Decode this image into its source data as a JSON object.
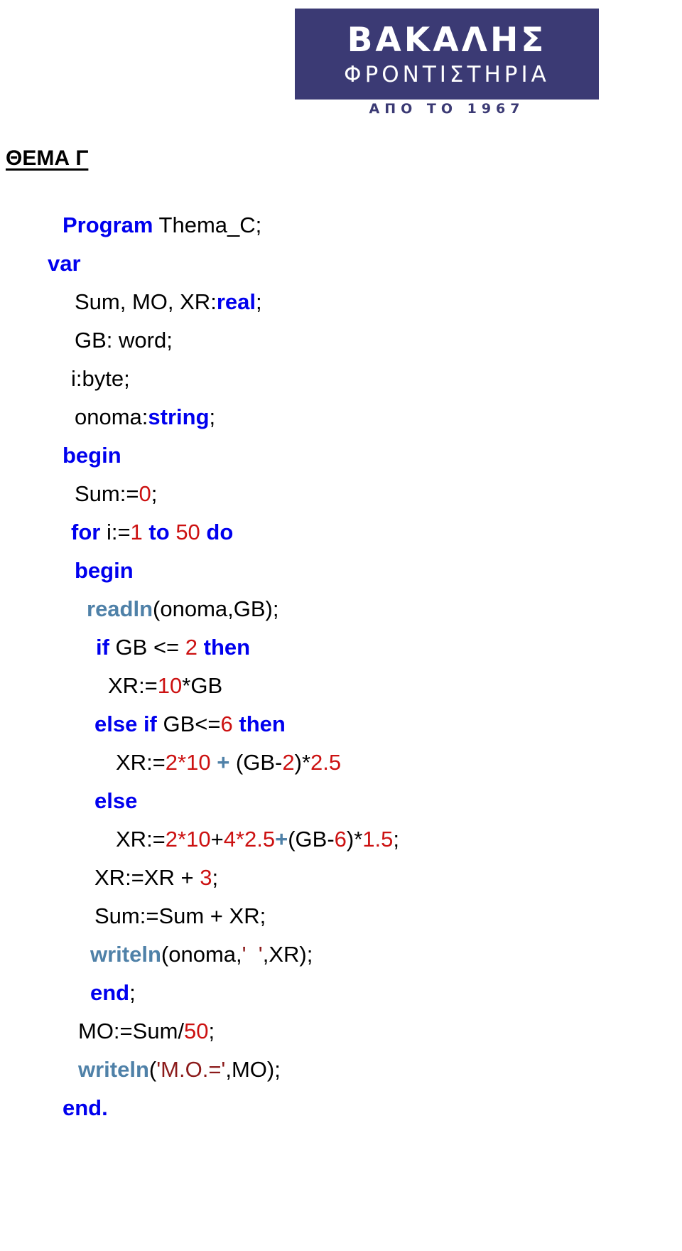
{
  "logo": {
    "brand": "ΒΑΚΑΛΗΣ",
    "subtitle": "ΦΡΟΝΤΙΣΤΗΡΙΑ",
    "since": "ΑΠΟ ΤΟ 1967",
    "box_color": "#3b3a74",
    "text_color": "#ffffff"
  },
  "heading": {
    "text": "ΘΕΜΑ Γ"
  },
  "colors": {
    "keyword": "#0000ee",
    "number": "#cc1111",
    "builtin": "#4f81a8",
    "string": "#8b1a1a",
    "plain": "#000000"
  },
  "code": {
    "language": "Pascal",
    "lines": [
      {
        "indent": 88,
        "tokens": [
          {
            "t": "Program",
            "c": "kw"
          },
          {
            "t": " Thema_C;",
            "c": "pl"
          }
        ]
      },
      {
        "indent": 67,
        "tokens": [
          {
            "t": "var",
            "c": "kw"
          }
        ]
      },
      {
        "indent": 105,
        "tokens": [
          {
            "t": "Sum, MO, XR:",
            "c": "pl"
          },
          {
            "t": "real",
            "c": "kw"
          },
          {
            "t": ";",
            "c": "pl"
          }
        ]
      },
      {
        "indent": 105,
        "tokens": [
          {
            "t": "GB: word;",
            "c": "pl"
          }
        ]
      },
      {
        "indent": 100,
        "tokens": [
          {
            "t": "i:byte;",
            "c": "pl"
          }
        ]
      },
      {
        "indent": 105,
        "tokens": [
          {
            "t": "onoma:",
            "c": "pl"
          },
          {
            "t": "string",
            "c": "kw"
          },
          {
            "t": ";",
            "c": "pl"
          }
        ]
      },
      {
        "indent": 88,
        "tokens": [
          {
            "t": "begin",
            "c": "kw"
          }
        ]
      },
      {
        "indent": 105,
        "tokens": [
          {
            "t": "Sum:=",
            "c": "pl"
          },
          {
            "t": "0",
            "c": "num"
          },
          {
            "t": ";",
            "c": "pl"
          }
        ]
      },
      {
        "indent": 100,
        "tokens": [
          {
            "t": "for",
            "c": "kw"
          },
          {
            "t": " i:=",
            "c": "pl"
          },
          {
            "t": "1",
            "c": "num"
          },
          {
            "t": " ",
            "c": "pl"
          },
          {
            "t": "to",
            "c": "kw"
          },
          {
            "t": " ",
            "c": "pl"
          },
          {
            "t": "50",
            "c": "num"
          },
          {
            "t": " ",
            "c": "pl"
          },
          {
            "t": "do",
            "c": "kw"
          }
        ]
      },
      {
        "indent": 105,
        "tokens": [
          {
            "t": "begin",
            "c": "kw"
          }
        ]
      },
      {
        "indent": 122,
        "tokens": [
          {
            "t": "readln",
            "c": "fn"
          },
          {
            "t": "(onoma,GB);",
            "c": "pl"
          }
        ]
      },
      {
        "indent": 135,
        "tokens": [
          {
            "t": "if",
            "c": "kw"
          },
          {
            "t": " GB <= ",
            "c": "pl"
          },
          {
            "t": "2",
            "c": "num"
          },
          {
            "t": " ",
            "c": "pl"
          },
          {
            "t": "then",
            "c": "kw"
          }
        ]
      },
      {
        "indent": 152,
        "tokens": [
          {
            "t": "XR:=",
            "c": "pl"
          },
          {
            "t": "10",
            "c": "num"
          },
          {
            "t": "*GB",
            "c": "pl"
          }
        ]
      },
      {
        "indent": 133,
        "tokens": [
          {
            "t": "else if",
            "c": "kw"
          },
          {
            "t": " GB<=",
            "c": "pl"
          },
          {
            "t": "6",
            "c": "num"
          },
          {
            "t": " ",
            "c": "pl"
          },
          {
            "t": "then",
            "c": "kw"
          }
        ]
      },
      {
        "indent": 163,
        "tokens": [
          {
            "t": "XR:=",
            "c": "pl"
          },
          {
            "t": "2*10",
            "c": "num"
          },
          {
            "t": " ",
            "c": "pl"
          },
          {
            "t": "+",
            "c": "op"
          },
          {
            "t": " (GB-",
            "c": "pl"
          },
          {
            "t": "2",
            "c": "num"
          },
          {
            "t": ")*",
            "c": "pl"
          },
          {
            "t": "2.5",
            "c": "num"
          }
        ]
      },
      {
        "indent": 133,
        "tokens": [
          {
            "t": "else",
            "c": "kw"
          }
        ]
      },
      {
        "indent": 163,
        "tokens": [
          {
            "t": "XR:=",
            "c": "pl"
          },
          {
            "t": "2*10",
            "c": "num"
          },
          {
            "t": "+",
            "c": "pl"
          },
          {
            "t": "4*2.5",
            "c": "num"
          },
          {
            "t": "+",
            "c": "op"
          },
          {
            "t": "(GB-",
            "c": "pl"
          },
          {
            "t": "6",
            "c": "num"
          },
          {
            "t": ")*",
            "c": "pl"
          },
          {
            "t": "1.5",
            "c": "num"
          },
          {
            "t": ";",
            "c": "pl"
          }
        ]
      },
      {
        "indent": 133,
        "tokens": [
          {
            "t": "XR:=XR + ",
            "c": "pl"
          },
          {
            "t": "3",
            "c": "num"
          },
          {
            "t": ";",
            "c": "pl"
          }
        ]
      },
      {
        "indent": 133,
        "tokens": [
          {
            "t": "Sum:=Sum + XR;",
            "c": "pl"
          }
        ]
      },
      {
        "indent": 127,
        "tokens": [
          {
            "t": "writeln",
            "c": "fn"
          },
          {
            "t": "(onoma,",
            "c": "pl"
          },
          {
            "t": "'  '",
            "c": "str"
          },
          {
            "t": ",XR);",
            "c": "pl"
          }
        ]
      },
      {
        "indent": 127,
        "tokens": [
          {
            "t": "end",
            "c": "kw"
          },
          {
            "t": ";",
            "c": "pl"
          }
        ]
      },
      {
        "indent": 110,
        "tokens": [
          {
            "t": "MO:=Sum/",
            "c": "pl"
          },
          {
            "t": "50",
            "c": "num"
          },
          {
            "t": ";",
            "c": "pl"
          }
        ]
      },
      {
        "indent": 110,
        "tokens": [
          {
            "t": "writeln",
            "c": "fn"
          },
          {
            "t": "(",
            "c": "pl"
          },
          {
            "t": "'M.O.='",
            "c": "str"
          },
          {
            "t": ",MO);",
            "c": "pl"
          }
        ]
      },
      {
        "indent": 88,
        "tokens": [
          {
            "t": "end.",
            "c": "kw"
          }
        ]
      }
    ]
  }
}
